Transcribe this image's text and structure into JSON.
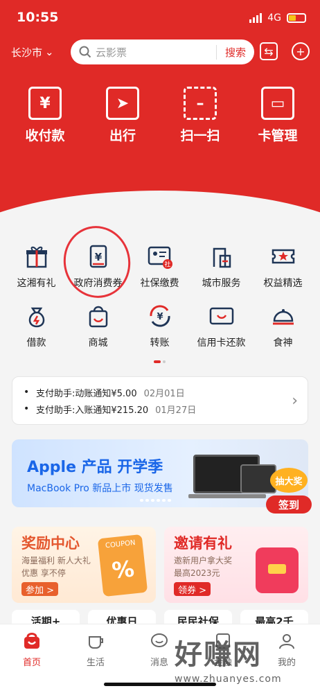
{
  "status": {
    "time": "10:55",
    "network": "4G"
  },
  "header": {
    "city": "长沙市",
    "search_placeholder": "云影票",
    "search_button": "搜索"
  },
  "quick_actions": [
    {
      "label": "收付款",
      "icon": "yen-scan-icon"
    },
    {
      "label": "出行",
      "icon": "navigation-arrow-icon"
    },
    {
      "label": "扫一扫",
      "icon": "scan-icon"
    },
    {
      "label": "卡管理",
      "icon": "card-icon"
    }
  ],
  "services": [
    {
      "label": "这湘有礼",
      "icon": "gift-icon"
    },
    {
      "label": "政府消费券",
      "icon": "voucher-icon"
    },
    {
      "label": "社保缴费",
      "icon": "social-security-icon",
      "badge": "社"
    },
    {
      "label": "城市服务",
      "icon": "city-service-icon"
    },
    {
      "label": "权益精选",
      "icon": "ticket-star-icon"
    },
    {
      "label": "借款",
      "icon": "loan-bag-icon"
    },
    {
      "label": "商城",
      "icon": "shopping-bag-icon"
    },
    {
      "label": "转账",
      "icon": "transfer-icon"
    },
    {
      "label": "信用卡还款",
      "icon": "credit-card-icon"
    },
    {
      "label": "食神",
      "icon": "food-cloche-icon"
    }
  ],
  "notices": [
    {
      "text": "支付助手:动账通知¥5.00",
      "date": "02月01日"
    },
    {
      "text": "支付助手:入账通知¥215.20",
      "date": "01月27日"
    }
  ],
  "banner": {
    "title": "Apple 产品 开学季",
    "subtitle": "MacBook Pro 新品上市 现货发售"
  },
  "lottery": {
    "top": "抽大奖",
    "button": "签到"
  },
  "promos": [
    {
      "title": "奖励中心",
      "line1": "海量福利 新人大礼",
      "line2": "优惠 享不停",
      "button": "参加 >",
      "deco": "COUPON",
      "deco_symbol": "%"
    },
    {
      "title": "邀请有礼",
      "line1": "邀新用户拿大奖",
      "line2": "最高2023元",
      "button": "领券 >"
    }
  ],
  "category_tabs": [
    "活期+",
    "优惠日",
    "民民社保",
    "最高2千"
  ],
  "nav": [
    {
      "label": "首页",
      "icon": "home-icon",
      "active": true
    },
    {
      "label": "生活",
      "icon": "cup-icon",
      "active": false
    },
    {
      "label": "消息",
      "icon": "message-icon",
      "active": false
    },
    {
      "label": "金融",
      "icon": "finance-icon",
      "active": false
    },
    {
      "label": "我的",
      "icon": "profile-icon",
      "active": false
    }
  ],
  "watermark": {
    "main": "好赚网",
    "sub": "www.zhuanyes.com"
  },
  "colors": {
    "brand_red": "#e02a27",
    "navy": "#1f3556",
    "banner_blue": "#1a66e8"
  }
}
